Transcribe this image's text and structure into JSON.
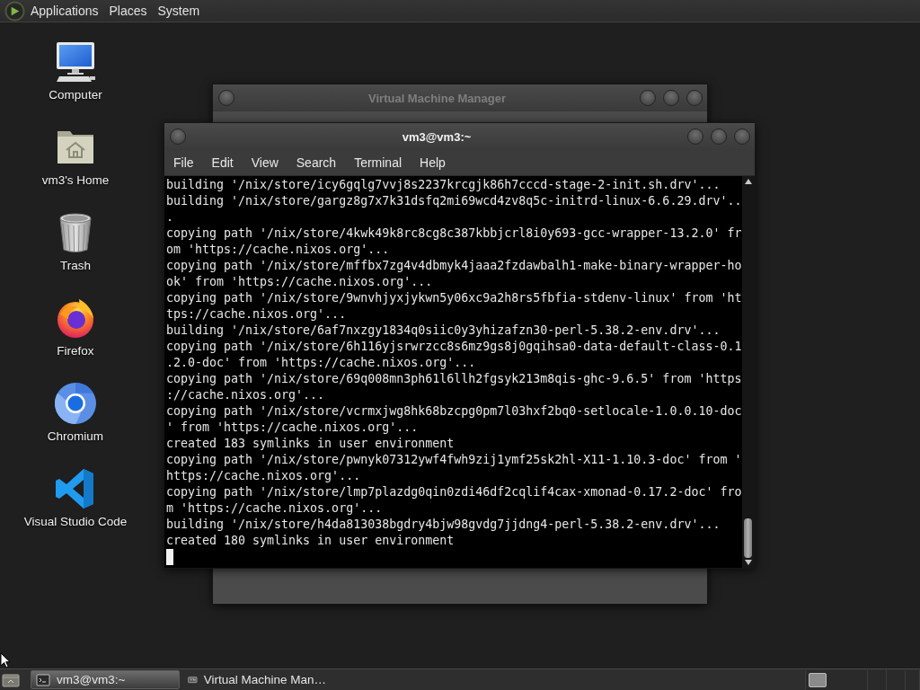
{
  "top_panel": {
    "menus": [
      "Applications",
      "Places",
      "System"
    ]
  },
  "desktop_icons": [
    {
      "kind": "computer",
      "label": "Computer"
    },
    {
      "kind": "home",
      "label": "vm3's Home"
    },
    {
      "kind": "trash",
      "label": "Trash"
    },
    {
      "kind": "firefox",
      "label": "Firefox"
    },
    {
      "kind": "chromium",
      "label": "Chromium"
    },
    {
      "kind": "vscode",
      "label": "Visual Studio Code"
    }
  ],
  "back_window": {
    "title": "Virtual Machine Manager",
    "active": false
  },
  "terminal_window": {
    "title": "vm3@vm3:~",
    "active": true,
    "menus": [
      "File",
      "Edit",
      "View",
      "Search",
      "Terminal",
      "Help"
    ],
    "lines": [
      "building '/nix/store/icy6gqlg7vvj8s2237krcgjk86h7cccd-stage-2-init.sh.drv'...",
      "building '/nix/store/gargz8g7x7k31dsfq2mi69wcd4zv8q5c-initrd-linux-6.6.29.drv'..",
      ".",
      "copying path '/nix/store/4kwk49k8rc8cg8c387kbbjcrl8i0y693-gcc-wrapper-13.2.0' fr",
      "om 'https://cache.nixos.org'...",
      "copying path '/nix/store/mffbx7zg4v4dbmyk4jaaa2fzdawbalh1-make-binary-wrapper-ho",
      "ok' from 'https://cache.nixos.org'...",
      "copying path '/nix/store/9wnvhjyxjykwn5y06xc9a2h8rs5fbfia-stdenv-linux' from 'ht",
      "tps://cache.nixos.org'...",
      "building '/nix/store/6af7nxzgy1834q0siic0y3yhizafzn30-perl-5.38.2-env.drv'...",
      "copying path '/nix/store/6h116yjsrwrzcc8s6mz9gs8j0gqihsa0-data-default-class-0.1",
      ".2.0-doc' from 'https://cache.nixos.org'...",
      "copying path '/nix/store/69q008mn3ph61l6llh2fgsyk213m8qis-ghc-9.6.5' from 'https",
      "://cache.nixos.org'...",
      "copying path '/nix/store/vcrmxjwg8hk68bzcpg0pm7l03hxf2bq0-setlocale-1.0.0.10-doc",
      "' from 'https://cache.nixos.org'...",
      "created 183 symlinks in user environment",
      "copying path '/nix/store/pwnyk07312ywf4fwh9zij1ymf25sk2hl-X11-1.10.3-doc' from '",
      "https://cache.nixos.org'...",
      "copying path '/nix/store/lmp7plazdg0qin0zdi46df2cqlif4cax-xmonad-0.17.2-doc' fro",
      "m 'https://cache.nixos.org'...",
      "building '/nix/store/h4da813038bgdry4bjw98gvdg7jjdng4-perl-5.38.2-env.drv'...",
      "created 180 symlinks in user environment"
    ]
  },
  "taskbar": {
    "tasks": [
      {
        "kind": "terminal",
        "label": "vm3@vm3:~",
        "selected": true
      },
      {
        "kind": "vmm",
        "label": "Virtual Machine Man…",
        "selected": false
      }
    ]
  }
}
